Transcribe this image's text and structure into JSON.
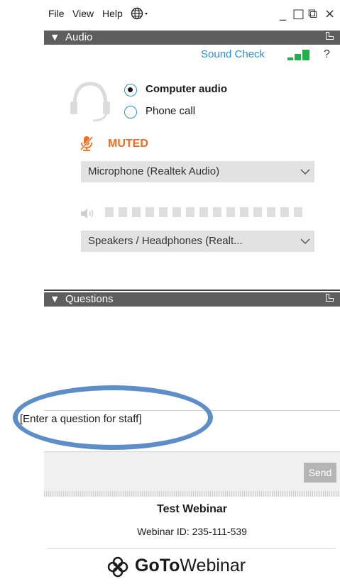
{
  "menu": {
    "file": "File",
    "view": "View",
    "help": "Help"
  },
  "window_controls": {
    "minimize": "_",
    "restore": "□",
    "popout": "⧉",
    "close": "×"
  },
  "audio_panel": {
    "title": "Audio",
    "sound_check": "Sound Check",
    "help": "?",
    "options": [
      {
        "label": "Computer audio",
        "selected": true
      },
      {
        "label": "Phone call",
        "selected": false
      }
    ],
    "status": "MUTED",
    "microphone": "Microphone (Realtek Audio)",
    "speakers": "Speakers / Headphones (Realt..."
  },
  "questions_panel": {
    "title": "Questions",
    "input_text": "[Enter a question for staff]",
    "send_label": "Send"
  },
  "footer": {
    "webinar_title": "Test Webinar",
    "webinar_id": "Webinar ID: 235-111-539",
    "logo_goto": "GoTo",
    "logo_webinar": "Webinar"
  },
  "colors": {
    "accent": "#2a8fd6",
    "muted": "#f26b22",
    "signal": "#21b04b",
    "header": "#5e5e5e",
    "highlight_ellipse": "#5e8ec7"
  },
  "icons": [
    "globe-icon",
    "headset-icon",
    "mic-muted-icon",
    "speaker-icon",
    "chevron-down-icon",
    "popout-icon",
    "goto-logo-icon"
  ]
}
